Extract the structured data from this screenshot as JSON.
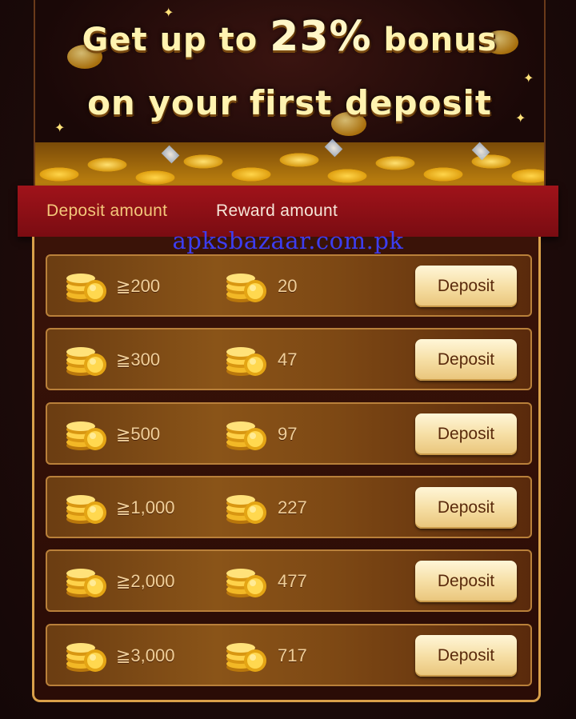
{
  "banner": {
    "line1_pre": "Get up to ",
    "line1_highlight": "23%",
    "line1_post": " bonus",
    "line2": "on your first deposit"
  },
  "header": {
    "deposit_label": "Deposit amount",
    "reward_label": "Reward amount"
  },
  "watermark": "apksbazaar.com.pk",
  "rows": [
    {
      "deposit": "≧200",
      "reward": "20",
      "button": "Deposit"
    },
    {
      "deposit": "≧300",
      "reward": "47",
      "button": "Deposit"
    },
    {
      "deposit": "≧500",
      "reward": "97",
      "button": "Deposit"
    },
    {
      "deposit": "≧1,000",
      "reward": "227",
      "button": "Deposit"
    },
    {
      "deposit": "≧2,000",
      "reward": "477",
      "button": "Deposit"
    },
    {
      "deposit": "≧3,000",
      "reward": "717",
      "button": "Deposit"
    }
  ],
  "icons": {
    "deposit": "coin-stack-icon",
    "reward": "coin-stack-icon"
  },
  "colors": {
    "header": "#8e1017",
    "button": "#f6dfa5",
    "border": "#d9a04a"
  }
}
